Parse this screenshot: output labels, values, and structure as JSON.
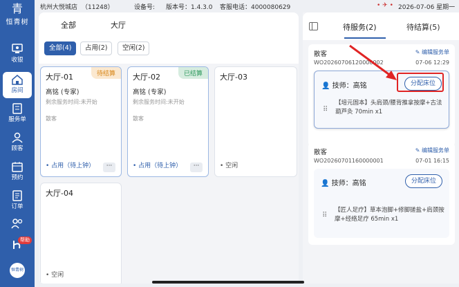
{
  "statusbar": {
    "store": "杭州大悦城店",
    "store_code": "（11248）",
    "device_no": "设备号:",
    "version": "版本号：1.4.3.0",
    "hotline": "客服电话：4000080629",
    "datetime": "2026-07-06 星期一"
  },
  "brand": {
    "mark": "青",
    "name": "恒青树"
  },
  "sidebar": {
    "items": [
      {
        "label": "收银",
        "icon": "cashier-icon"
      },
      {
        "label": "房间",
        "icon": "room-icon"
      },
      {
        "label": "服务单",
        "icon": "service-order-icon"
      },
      {
        "label": "顾客",
        "icon": "customer-icon"
      },
      {
        "label": "预约",
        "icon": "calendar-icon"
      },
      {
        "label": "订单",
        "icon": "order-icon"
      },
      {
        "label": "",
        "icon": "staff-icon"
      },
      {
        "label": "",
        "icon": "help-icon"
      }
    ],
    "help_badge": "帮助",
    "bottom_avatar": "恒青树"
  },
  "main": {
    "tabs": [
      {
        "label": "全部"
      },
      {
        "label": "大厅"
      }
    ],
    "filters": [
      {
        "label": "全部(4)"
      },
      {
        "label": "占用(2)"
      },
      {
        "label": "空闲(2)"
      }
    ],
    "rooms": [
      {
        "name": "大厅-01",
        "tag": "待结算",
        "tech": "高铭 (专家)",
        "remain": "剩余服务时间:未开始",
        "guest": "散客",
        "status": "• 占用（待上钟）",
        "more": "···"
      },
      {
        "name": "大厅-02",
        "tag": "已结算",
        "tech": "高铭 (专家)",
        "remain": "剩余服务时间:未开始",
        "guest": "散客",
        "status": "• 占用（待上钟）",
        "more": "···"
      },
      {
        "name": "大厅-03",
        "status": "• 空闲"
      },
      {
        "name": "大厅-04",
        "status": "• 空闲"
      }
    ]
  },
  "right": {
    "tabs": [
      {
        "label": "待服务(2)"
      },
      {
        "label": "待结算(5)"
      }
    ],
    "orders": [
      {
        "title": "散客",
        "edit": "编辑服务单",
        "order_no": "WO20260706120000002",
        "time": "07-06 12:29",
        "tech_label": "技师：",
        "tech_name": "高铭",
        "assign": "分配床位",
        "service": "【培元固本】头肩颈/腰背推拿按摩+古法葫芦灸 70min x1"
      },
      {
        "title": "散客",
        "edit": "编辑服务单",
        "order_no": "WO20260701160000001",
        "time": "07-01 16:15",
        "tech_label": "技师：",
        "tech_name": "高铭",
        "assign": "分配床位",
        "service": "【匠人足疗】草本泡脚+修脚搓盐+肩颈按摩+经络足疗 65min x1"
      }
    ]
  },
  "colors": {
    "primary": "#2f5fab",
    "pending": "#d8871a",
    "settled": "#2f9a5e",
    "highlight": "#e02424"
  }
}
